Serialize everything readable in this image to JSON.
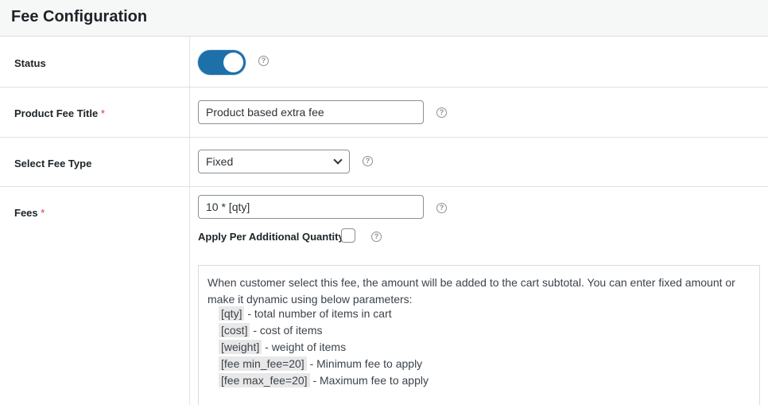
{
  "header": {
    "title": "Fee Configuration"
  },
  "rows": {
    "status": {
      "label": "Status",
      "enabled": true
    },
    "title": {
      "label": "Product Fee Title",
      "required_mark": "*",
      "value": "Product based extra fee"
    },
    "fee_type": {
      "label": "Select Fee Type",
      "selected": "Fixed"
    },
    "fees": {
      "label": "Fees",
      "required_mark": "*",
      "value": "10 * [qty]",
      "apply_per_qty_label": "Apply Per Additional Quantity",
      "apply_per_qty_checked": false
    }
  },
  "help": {
    "glyph": "?"
  },
  "description": {
    "intro": "When customer select this fee, the amount will be added to the cart subtotal. You can enter fixed amount or make it dynamic using below parameters:",
    "params": [
      {
        "code": "[qty]",
        "text": " - total number of items in cart"
      },
      {
        "code": "[cost]",
        "text": " - cost of items"
      },
      {
        "code": "[weight]",
        "text": " - weight of items"
      },
      {
        "code": "[fee min_fee=20]",
        "text": " - Minimum fee to apply"
      },
      {
        "code": "[fee max_fee=20]",
        "text": " - Maximum fee to apply"
      }
    ]
  },
  "colors": {
    "accent": "#1e70a8",
    "required": "#d63638",
    "header_bg": "#f6f7f7"
  }
}
